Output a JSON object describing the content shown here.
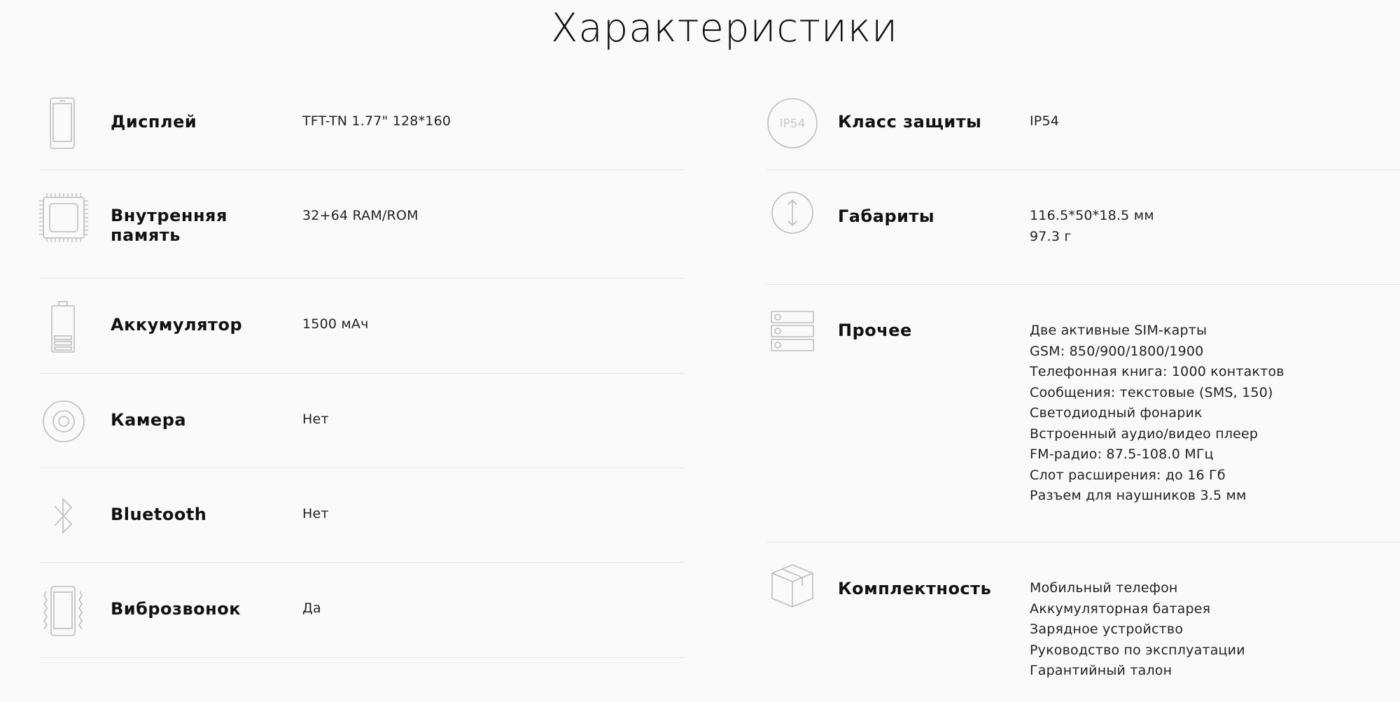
{
  "page": {
    "title": "Характеристики"
  },
  "specs_left": [
    {
      "label": "Дисплей",
      "values": [
        "TFT-TN 1.77\" 128*160"
      ],
      "icon": "phone-display-icon"
    },
    {
      "label": "Внутренняя память",
      "values": [
        "32+64 RAM/ROM"
      ],
      "icon": "chip-icon"
    },
    {
      "label": "Аккумулятор",
      "values": [
        "1500 мАч"
      ],
      "icon": "battery-icon"
    },
    {
      "label": "Камера",
      "values": [
        "Нет"
      ],
      "icon": "camera-lens-icon"
    },
    {
      "label": "Bluetooth",
      "values": [
        "Нет"
      ],
      "icon": "bluetooth-icon"
    },
    {
      "label": "Виброзвонок",
      "values": [
        "Да"
      ],
      "icon": "vibration-icon"
    }
  ],
  "specs_right": [
    {
      "label": "Класс защиты",
      "values": [
        "IP54"
      ],
      "icon": "ip54-icon",
      "icon_text": "IP54"
    },
    {
      "label": "Габариты",
      "values": [
        "116.5*50*18.5 мм",
        "97.3 г"
      ],
      "icon": "dimensions-icon"
    },
    {
      "label": "Прочее",
      "values": [
        "Две активные SIM-карты",
        "GSM: 850/900/1800/1900",
        "Телефонная книга: 1000 контактов",
        "Сообщения: текстовые (SMS, 150)",
        "Светодиодный фонарик",
        "Встроенный аудио/видео плеер",
        "FM-радио: 87.5-108.0 МГц",
        "Слот расширения: до 16 Гб",
        "Разъем для наушников 3.5 мм"
      ],
      "icon": "server-list-icon"
    },
    {
      "label": "Комплектность",
      "values": [
        "Мобильный телефон",
        "Аккумуляторная батарея",
        "Зарядное устройство",
        "Руководство по эксплуатации",
        "Гарантийный талон"
      ],
      "icon": "box-icon"
    }
  ]
}
